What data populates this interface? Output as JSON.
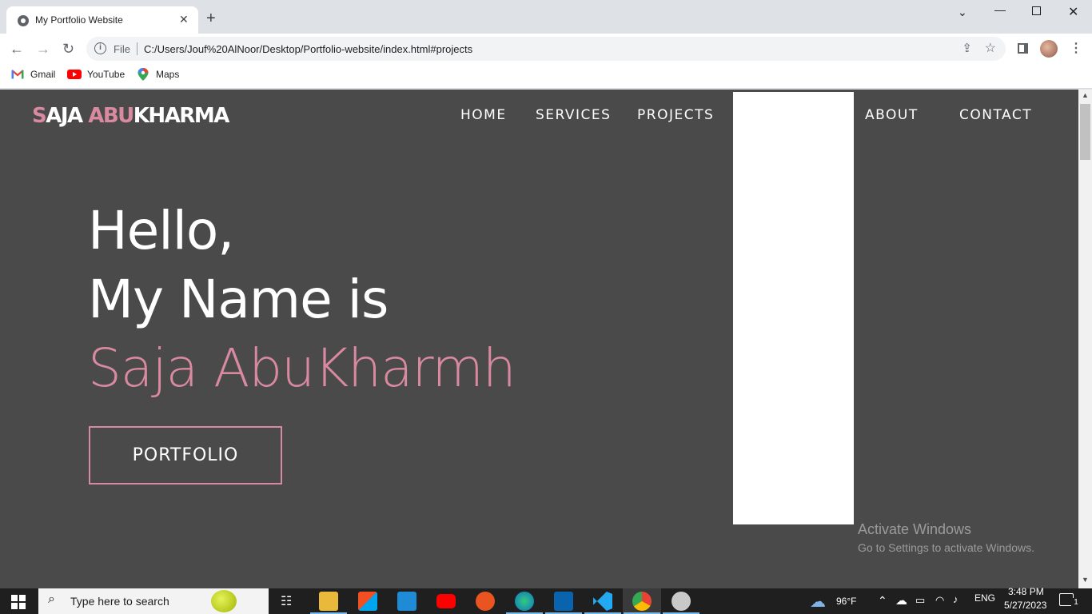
{
  "browser": {
    "tab_title": "My Portfolio Website",
    "tab_close": "✕",
    "new_tab": "+",
    "address_scheme": "File",
    "address_url": "C:/Users/Jouf%20AlNoor/Desktop/Portfolio-website/index.html#projects",
    "bookmarks": [
      {
        "label": "Gmail",
        "icon": "gmail-icon"
      },
      {
        "label": "YouTube",
        "icon": "youtube-icon"
      },
      {
        "label": "Maps",
        "icon": "maps-icon"
      }
    ]
  },
  "site": {
    "logo_first_letter": "S",
    "logo_first_rest": "AJA",
    "logo_second_pink": "ABU",
    "logo_second_rest": "KHARMA",
    "nav": [
      "HOME",
      "SERVICES",
      "PROJECTS",
      "ABOUT",
      "CONTACT"
    ],
    "hero_line1": "Hello,",
    "hero_line2": "My Name is",
    "hero_name": "Saja AbuKharmh",
    "cta_label": "PORTFOLIO"
  },
  "watermark": {
    "title": "Activate Windows",
    "subtitle": "Go to Settings to activate Windows."
  },
  "taskbar": {
    "search_placeholder": "Type here to search",
    "weather": "96°F",
    "language": "ENG",
    "time": "3:48 PM",
    "date": "5/27/2023",
    "notification_count": "1"
  },
  "colors": {
    "accent_pink": "#d98aa0",
    "page_bg": "#4a4a4b"
  }
}
